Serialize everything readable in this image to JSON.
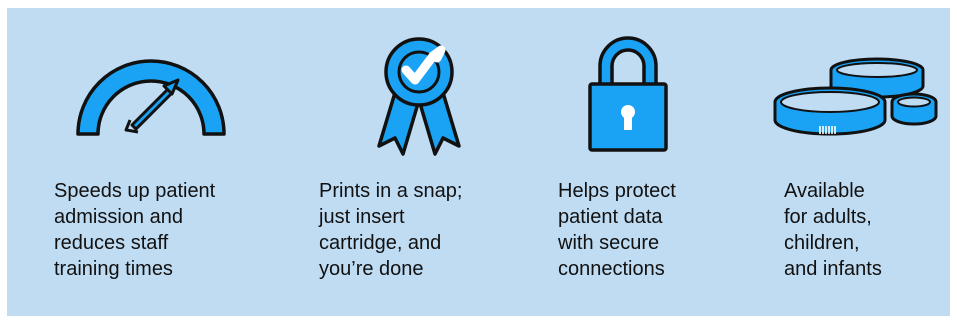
{
  "colors": {
    "background": "#bfdcf3",
    "icon_fill": "#1aa3f5",
    "icon_stroke": "#111111",
    "text": "#111111"
  },
  "features": [
    {
      "icon": "speedometer-icon",
      "caption": "Speeds up patient\nadmission and\nreduces staff\ntraining times"
    },
    {
      "icon": "ribbon-badge-icon",
      "caption": "Prints in a snap;\njust insert\ncartridge, and\nyou’re done"
    },
    {
      "icon": "padlock-icon",
      "caption": "Helps protect\npatient data\nwith secure\nconnections"
    },
    {
      "icon": "wristbands-icon",
      "caption": "Available\nfor adults,\nchildren,\nand infants"
    }
  ]
}
